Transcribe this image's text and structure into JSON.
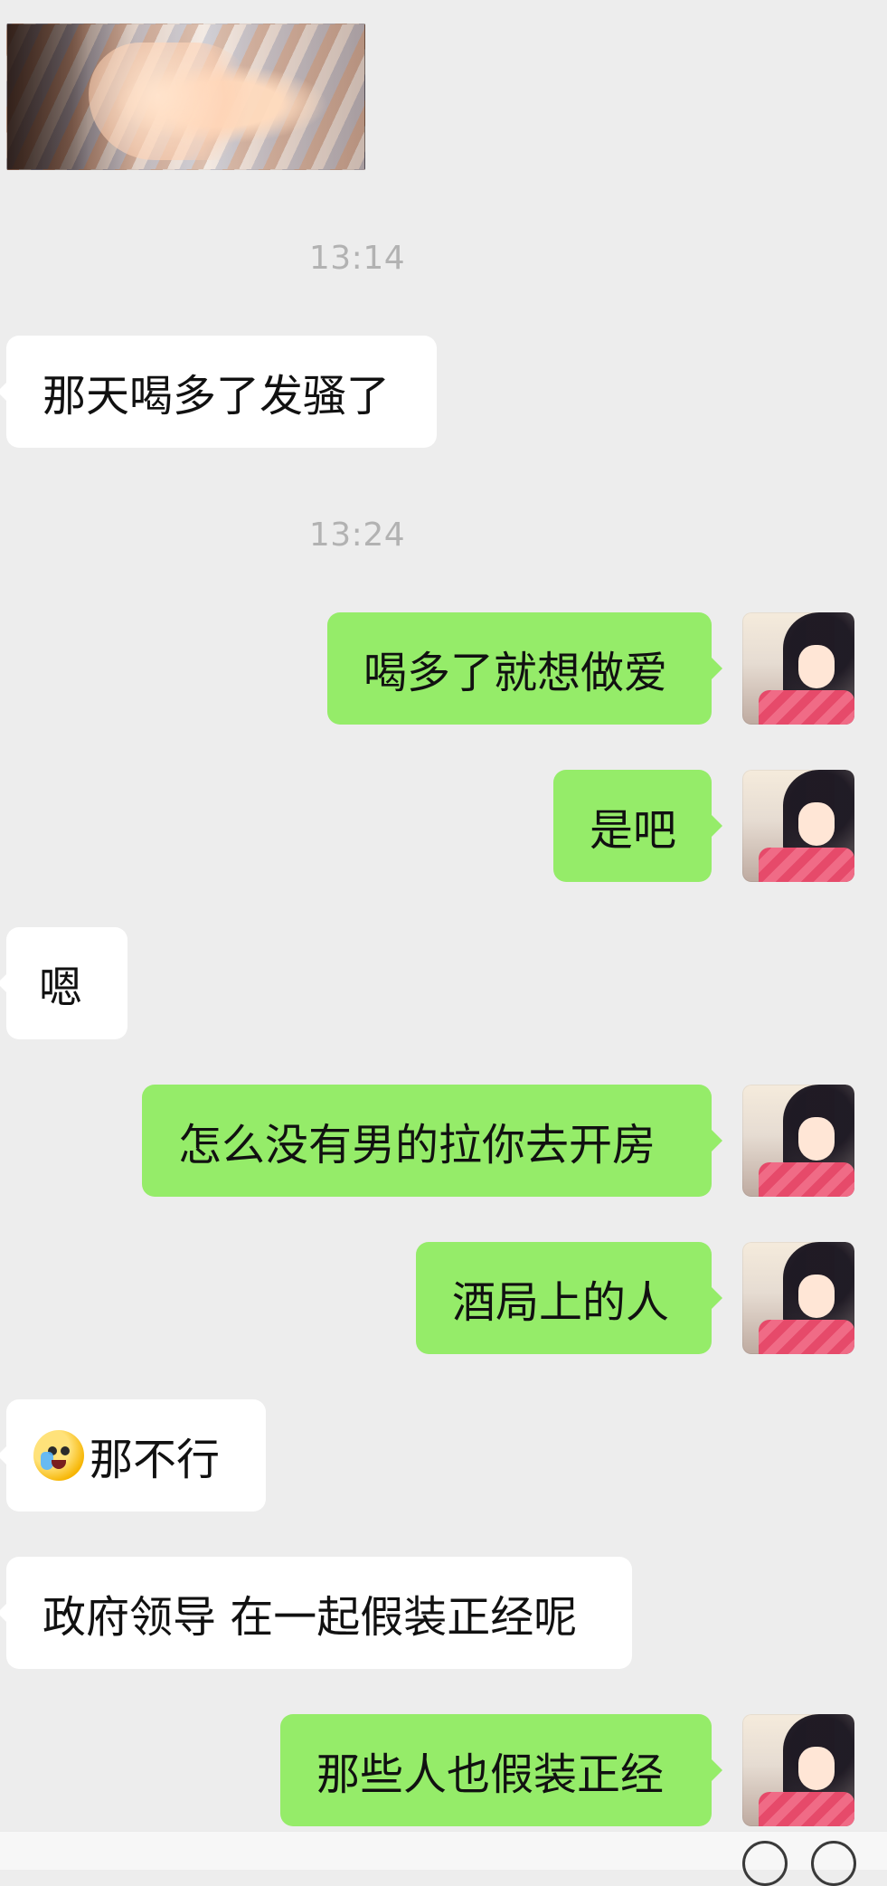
{
  "chat": {
    "timestamps": [
      "13:14",
      "13:24"
    ],
    "messages": [
      {
        "text": "那天喝多了发骚了"
      },
      {
        "text": "喝多了就想做爱"
      },
      {
        "text": "是吧"
      },
      {
        "text": "嗯"
      },
      {
        "text": "怎么没有男的拉你去开房"
      },
      {
        "text": "酒局上的人"
      },
      {
        "text": "那不行"
      },
      {
        "text": "政府领导 在一起假装正经呢"
      },
      {
        "text": "那些人也假装正经"
      }
    ]
  },
  "icons": {
    "emoji": "crying-laughing-emoji",
    "bottom_left_circle": "circle-icon",
    "bottom_right_circle": "circle-icon"
  },
  "colors": {
    "background": "#ededed",
    "incoming_bubble": "#ffffff",
    "outgoing_bubble": "#95ec69",
    "timestamp": "#b2b2b2"
  }
}
